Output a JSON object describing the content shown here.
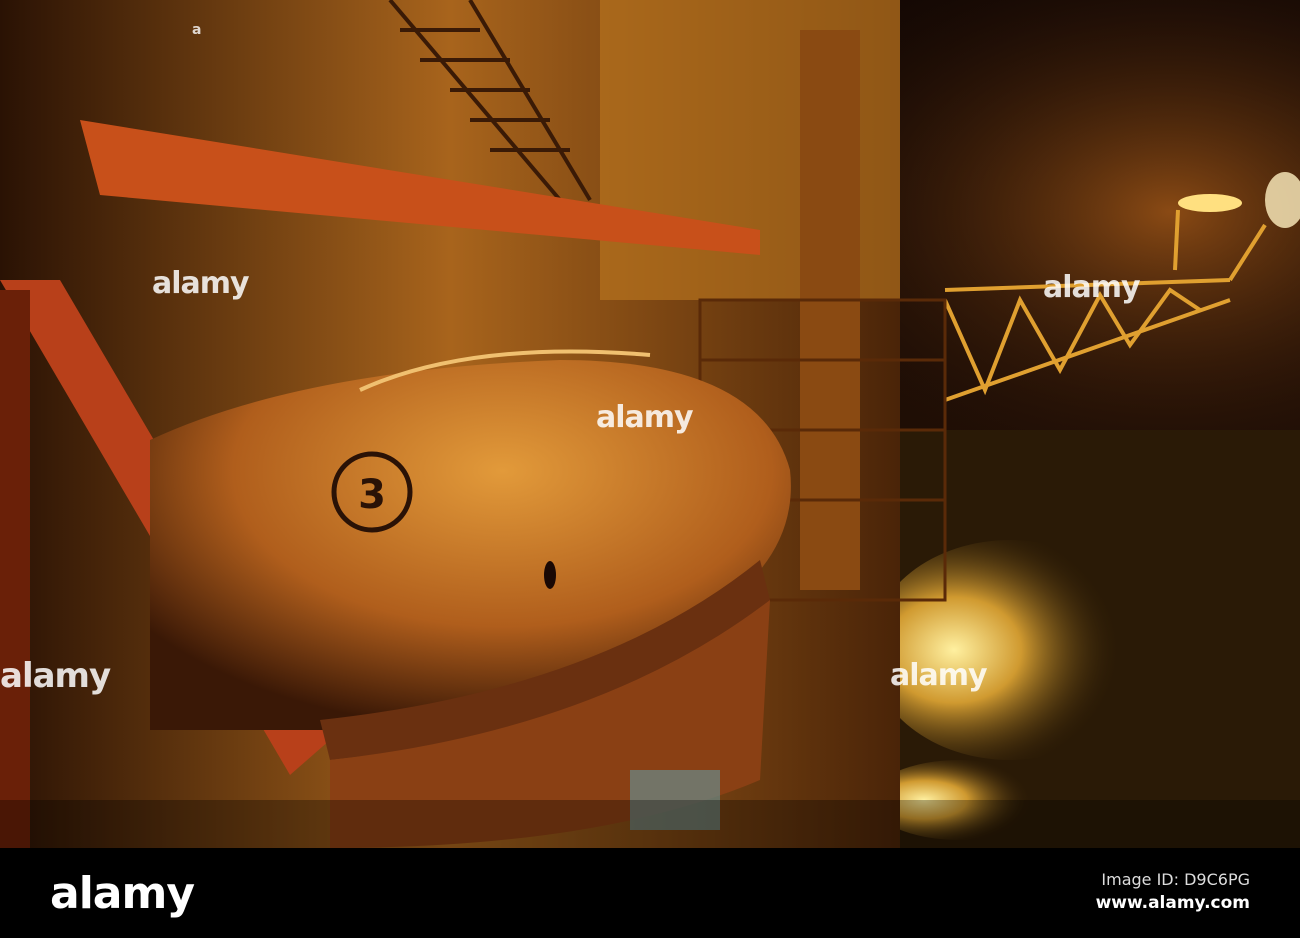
{
  "photo": {
    "subject": "lifeboat",
    "lifeboat_number": "3",
    "colors": {
      "sky": "#1a0a04",
      "structure": "#c8601a",
      "glow": "#f0b040",
      "sea": "#2a1a06"
    }
  },
  "watermark": {
    "text": "alamy"
  },
  "footer": {
    "logo": "alamy",
    "image_id": "Image ID: D9C6PG",
    "website": "www.alamy.com"
  }
}
